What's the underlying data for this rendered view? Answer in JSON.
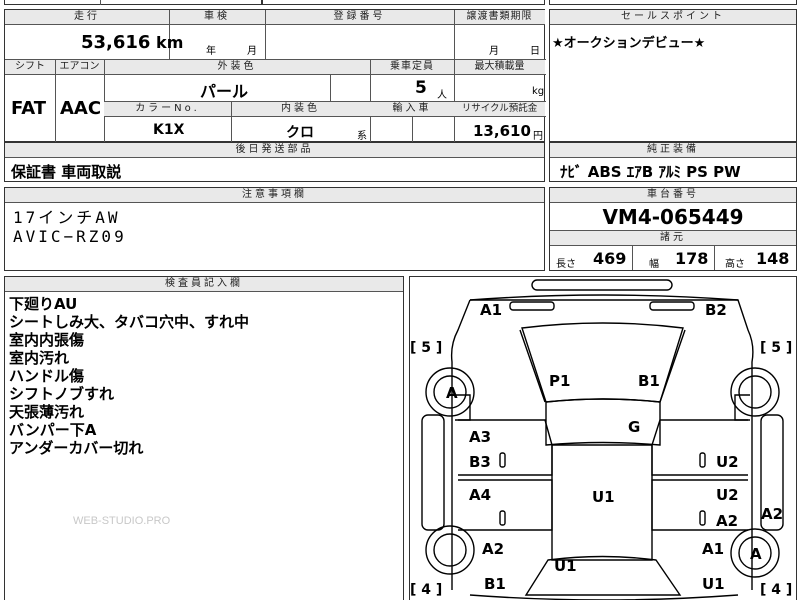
{
  "mileage": {
    "label": "走行",
    "value": "53,616",
    "unit": "km"
  },
  "inspection": {
    "label": "車検",
    "year_unit": "年",
    "month_unit": "月"
  },
  "registration": {
    "label": "登録番号"
  },
  "transfer_deadline": {
    "label": "譲渡書類期限",
    "month_unit": "月",
    "day_unit": "日"
  },
  "sales_point": {
    "label": "セールスポイント",
    "text": "★オークションデビュー★"
  },
  "shift": {
    "label": "シフト",
    "value": "FAT"
  },
  "aircon": {
    "label": "エアコン",
    "value": "AAC"
  },
  "exterior_color": {
    "label": "外装色",
    "value": "パール"
  },
  "capacity": {
    "label": "乗車定員",
    "value": "5",
    "unit": "人"
  },
  "max_load": {
    "label": "最大積載量",
    "unit": "kg"
  },
  "color_no": {
    "label": "カラーNo.",
    "value": "K1X"
  },
  "interior_color": {
    "label": "内装色",
    "value": "クロ",
    "suffix": "系"
  },
  "import": {
    "label": "輸入車"
  },
  "recycle": {
    "label": "リサイクル預託金",
    "value": "13,610",
    "unit": "円"
  },
  "later_parts": {
    "label": "後日発送部品",
    "value": "保証書 車両取説"
  },
  "equipment": {
    "label": "純正装備",
    "value": "ﾅﾋﾞ ABS ｴｱB ｱﾙﾐ PS PW"
  },
  "notes": {
    "label": "注意事項欄",
    "text": "17インチAW\nAVIC−RZ09"
  },
  "chassis": {
    "label": "車台番号",
    "value": "VM4-065449"
  },
  "specs": {
    "label": "諸元",
    "length_label": "長さ",
    "length": "469",
    "width_label": "幅",
    "width": "178",
    "height_label": "高さ",
    "height": "148"
  },
  "inspector": {
    "label": "検査員記入欄",
    "text": "下廻りAU\nシートしみ大、タバコ穴中、すれ中\n室内内張傷\n室内汚れ\nハンドル傷\nシフトノブすれ\n天張薄汚れ\nバンパー下A\nアンダーカバー切れ"
  },
  "watermark": "WEB-STUDIO.PRO",
  "diagram": {
    "tire_left": "[ 5 ]",
    "tire_right": "[ 5 ]",
    "tire_bl": "[ 4 ]",
    "tire_br": "[ 4 ]",
    "wheel_fl": "A",
    "wheel_rr": "A",
    "marks": {
      "front_left": "A1",
      "front_right": "B2",
      "seat_left": "P1",
      "seat_right": "B1",
      "roof": "G",
      "door_l1": "A3",
      "door_l2": "B3",
      "door_r1": "U2",
      "door_l3": "A4",
      "floor": "U1",
      "door_r2": "U2",
      "door_r3": "A2",
      "side_r": "A2",
      "rear_l": "A2",
      "rear_r": "A1",
      "bottom_l": "B1",
      "bottom_c": "U1",
      "bottom_r": "U1"
    }
  }
}
